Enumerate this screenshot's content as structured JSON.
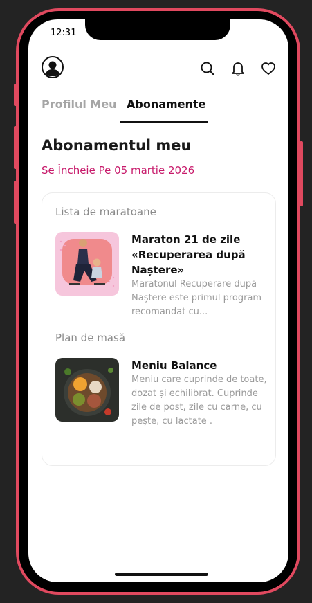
{
  "status_bar": {
    "time": "12:31"
  },
  "tabs": [
    {
      "label": "Profilul Meu",
      "active": false
    },
    {
      "label": "Abonamente",
      "active": true
    }
  ],
  "page": {
    "title": "Abonamentul meu",
    "subtitle": "Se Încheie Pe 05 martie 2026"
  },
  "sections": {
    "marathons": {
      "label": "Lista de maratoane",
      "items": [
        {
          "title": "Maraton 21 de zile «Recuperarea după Naștere»",
          "description": "Maratonul Recuperare după Naștere este primul program recomandat cu..."
        }
      ]
    },
    "meal_plans": {
      "label": "Plan de masă",
      "items": [
        {
          "title": "Meniu Balance",
          "description": "Meniu care cuprinde de toate, dozat și echilibrat. Cuprinde zile de post, zile cu carne, cu pește, cu lactate ."
        }
      ]
    }
  },
  "icons": [
    "avatar-icon",
    "search-icon",
    "bell-icon",
    "heart-icon"
  ],
  "colors": {
    "accent": "#c7196a",
    "frame": "#e0495f",
    "background": "#232323"
  }
}
